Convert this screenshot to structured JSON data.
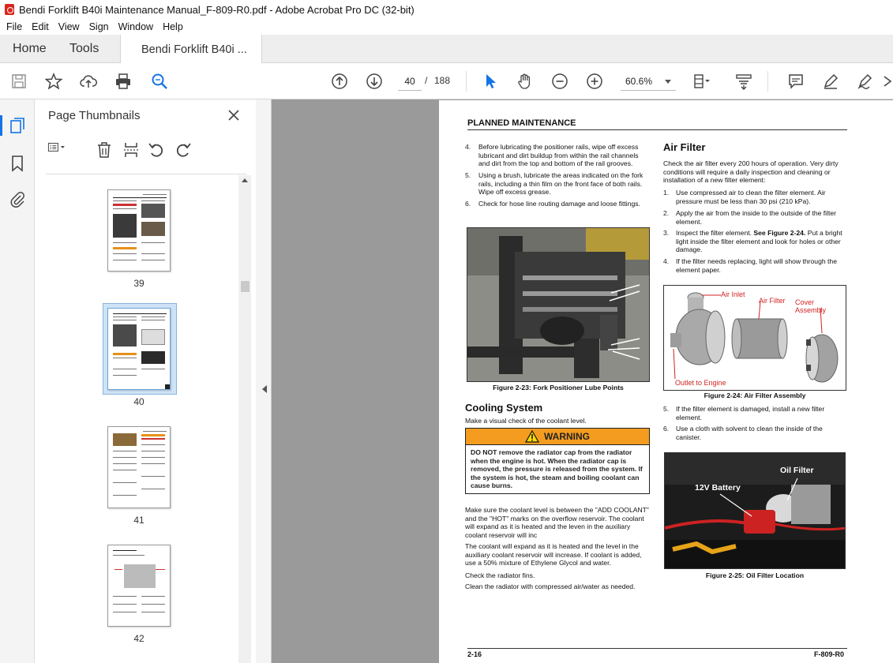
{
  "window": {
    "title": "Bendi Forklift B40i Maintenance Manual_F-809-R0.pdf - Adobe Acrobat Pro DC (32-bit)"
  },
  "menu": [
    "File",
    "Edit",
    "View",
    "Sign",
    "Window",
    "Help"
  ],
  "tabs": {
    "home": "Home",
    "tools": "Tools",
    "document": "Bendi Forklift B40i ..."
  },
  "toolbar": {
    "current_page": "40",
    "separator": "/",
    "total_pages": "188",
    "zoom": "60.6%"
  },
  "thumbnails_panel": {
    "title": "Page Thumbnails",
    "pages": [
      "39",
      "40",
      "41",
      "42"
    ],
    "selected": "40"
  },
  "page": {
    "header": "PLANNED MAINTENANCE",
    "left_list": [
      {
        "n": "4.",
        "text": "Before lubricating the positioner rails, wipe off excess lubricant and dirt buildup from within the rail channels and dirt from the top and bottom of the rail grooves."
      },
      {
        "n": "5.",
        "text": "Using a brush, lubricate the areas indicated on the fork rails, including a thin film on the front face of both rails. Wipe off excess grease."
      },
      {
        "n": "6.",
        "text": "Check for hose line routing damage and loose fittings."
      }
    ],
    "fig23_caption": "Figure 2-23:  Fork Positioner Lube Points",
    "cooling_title": "Cooling System",
    "cooling_intro": "Make a visual check of the coolant level.",
    "warning_title": "WARNING",
    "warning_text": "DO NOT remove the radiator cap from the radiator when the engine is hot. When the radiator cap is removed, the pressure is released from the system. If the system is hot, the steam and boiling coolant can cause burns.",
    "cooling_p1": "Make sure the coolant level is between the \"ADD COOLANT\" and the \"HOT\" marks on the overflow reservoir. The coolant will expand as it is heated and the leven in the auxiliary coolant reservoir will inc",
    "cooling_p2": "The coolant will expand as it is heated and the level in the auxiliary coolant reservoir will increase. If coolant is added, use a 50% mixture of Ethylene Glycol and water.",
    "cooling_p3": "Check the radiator fins.",
    "cooling_p4": "Clean the radiator with compressed air/water as needed.",
    "air_title": "Air Filter",
    "air_intro": "Check the air filter every 200 hours of operation. Very dirty conditions will require a daily inspection and cleaning or installation of a new filter element:",
    "air_list": [
      {
        "n": "1.",
        "text": "Use compressed air to clean the filter element. Air pressure must be less than 30 psi (210 kPa)."
      },
      {
        "n": "2.",
        "text": "Apply the air from the inside to the outside of the filter element."
      },
      {
        "n": "3.",
        "pre": "Inspect the filter element. ",
        "bold": "See Figure 2-24.",
        "post": " Put a bright light inside the filter element and look for holes or other damage."
      },
      {
        "n": "4.",
        "text": "If the filter needs replacing, light will show through the element paper."
      }
    ],
    "fig24_labels": {
      "air_inlet": "Air Inlet",
      "air_filter": "Air Filter",
      "cover": "Cover Assembly",
      "outlet": "Outlet to Engine"
    },
    "fig24_caption": "Figure 2-24:  Air Filter Assembly",
    "air_list2": [
      {
        "n": "5.",
        "text": "If the filter element is damaged, install a new filter element."
      },
      {
        "n": "6.",
        "text": "Use a cloth with solvent to clean the inside of the canister."
      }
    ],
    "fig25_labels": {
      "battery": "12V Battery",
      "oil": "Oil Filter"
    },
    "fig25_caption": "Figure 2-25:  Oil Filter Location",
    "footer_left": "2-16",
    "footer_right": "F-809-R0"
  },
  "colors": {
    "accent": "#1473e6",
    "warning": "#f39c1f",
    "label_red": "#d22222"
  }
}
